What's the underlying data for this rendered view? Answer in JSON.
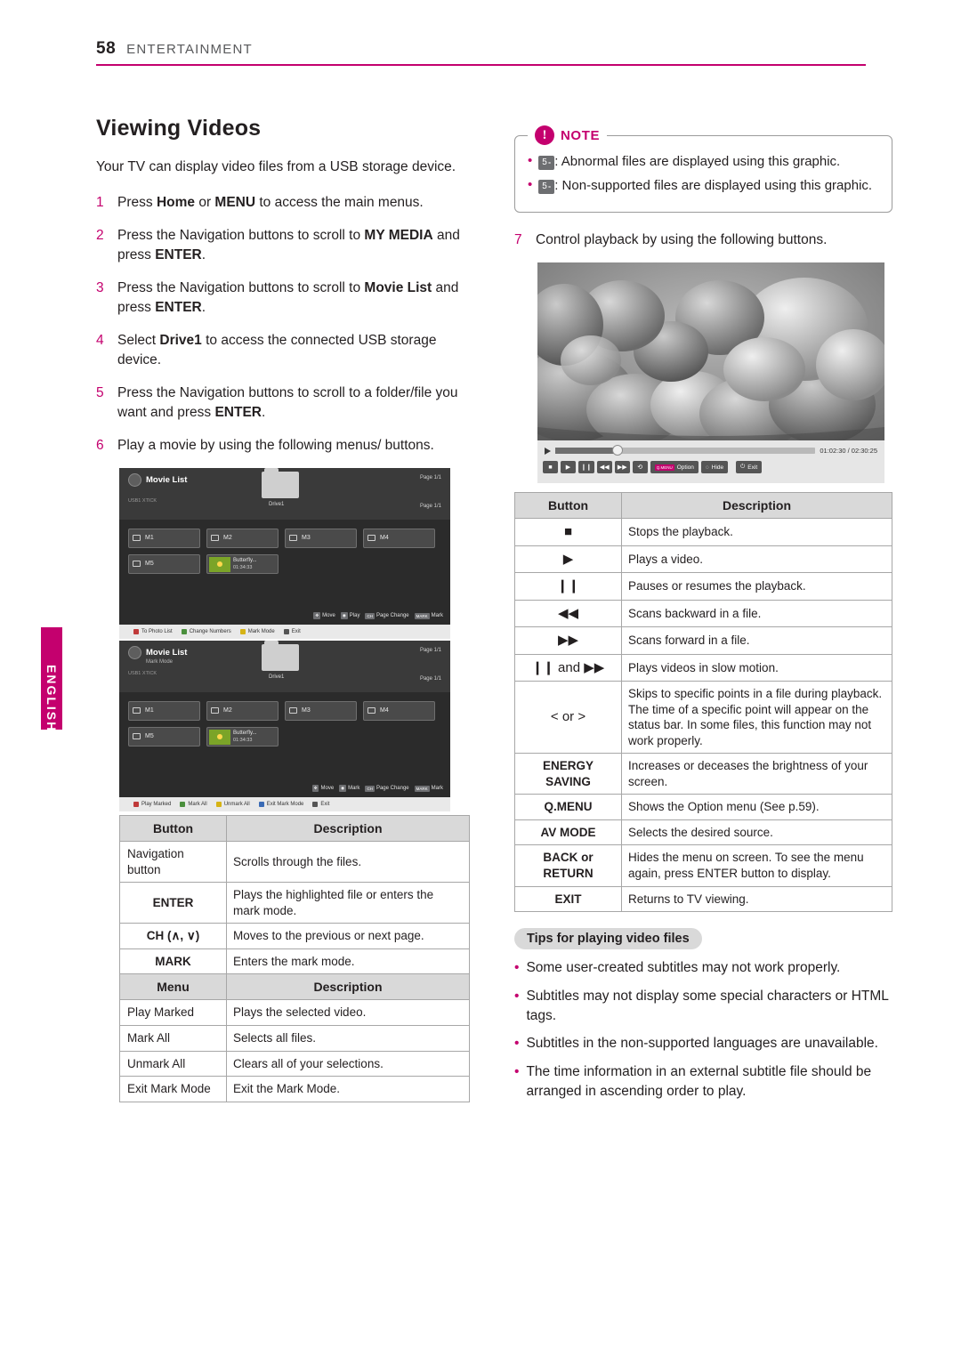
{
  "header": {
    "page_number": "58",
    "title": "ENTERTAINMENT"
  },
  "side_tab": {
    "label": "ENGLISH"
  },
  "left": {
    "section_title": "Viewing Videos",
    "intro": "Your TV can display video files from a USB storage device.",
    "steps": [
      {
        "n": "1",
        "html": "Press <b>Home</b> or <b>MENU</b> to access the main menus."
      },
      {
        "n": "2",
        "html": "Press the Navigation buttons to scroll to <b>MY MEDIA</b> and press <b>ENTER</b>."
      },
      {
        "n": "3",
        "html": "Press the Navigation buttons to scroll to <b>Movie List</b> and press <b>ENTER</b>."
      },
      {
        "n": "4",
        "html": "Select <b>Drive1</b> to access the connected USB storage device."
      },
      {
        "n": "5",
        "html": "Press the Navigation buttons to scroll to a folder/file you want and press <b>ENTER</b>."
      },
      {
        "n": "6",
        "html": "Play a movie by using the following menus/ buttons."
      }
    ],
    "button_table": {
      "headers": [
        "Button",
        "Description"
      ],
      "rows": [
        {
          "key": "Navigation button",
          "key_align": "left",
          "desc": "Scrolls through the files."
        },
        {
          "key": "ENTER",
          "key_align": "center",
          "desc": "Plays the highlighted file or enters the mark mode."
        },
        {
          "key": "CH (∧, ∨)",
          "key_align": "center",
          "desc": "Moves to the previous or next page."
        },
        {
          "key": "MARK",
          "key_align": "center",
          "desc": "Enters the mark mode."
        }
      ]
    },
    "menu_table": {
      "headers": [
        "Menu",
        "Description"
      ],
      "rows": [
        {
          "key": "Play Marked",
          "desc": "Plays the selected video."
        },
        {
          "key": "Mark All",
          "desc": "Selects all files."
        },
        {
          "key": "Unmark All",
          "desc": "Clears all of your selections."
        },
        {
          "key": "Exit Mark Mode",
          "desc": "Exit the Mark Mode."
        }
      ]
    },
    "mock1": {
      "title": "Movie List",
      "subtitle": "",
      "usb": "USB1 XTICK",
      "page_top": "Page 1/1",
      "page_right": "Page 1/1",
      "drive": "Drive1",
      "tiles_row1": [
        "M1",
        "M2",
        "M3",
        "M4"
      ],
      "tiles_row2": [
        "M5"
      ],
      "thumb_title": "Butterfly...",
      "thumb_time": "01:34:33",
      "hints": [
        {
          "k": "✥",
          "t": "Move"
        },
        {
          "k": "◉",
          "t": "Play"
        },
        {
          "k": "CH",
          "t": "Page Change"
        },
        {
          "k": "MARK",
          "t": "Mark"
        }
      ],
      "footer": [
        {
          "c": "r",
          "t": "To Photo List"
        },
        {
          "c": "g",
          "t": "Change Numbers"
        },
        {
          "c": "y",
          "t": "Mark Mode"
        },
        {
          "c": "k",
          "t": "Exit"
        }
      ]
    },
    "mock2": {
      "title": "Movie List",
      "subtitle": "Mark Mode",
      "usb": "USB1 XTICK",
      "page_top": "Page 1/1",
      "page_right": "Page 1/1",
      "drive": "Drive1",
      "tiles_row1": [
        "M1",
        "M2",
        "M3",
        "M4"
      ],
      "tiles_row2": [
        "M5"
      ],
      "thumb_title": "Butterfly...",
      "thumb_time": "01:34:33",
      "hints": [
        {
          "k": "✥",
          "t": "Move"
        },
        {
          "k": "◉",
          "t": "Mark"
        },
        {
          "k": "CH",
          "t": "Page Change"
        },
        {
          "k": "MARK",
          "t": "Mark"
        }
      ],
      "footer": [
        {
          "c": "r",
          "t": "Play Marked"
        },
        {
          "c": "g",
          "t": "Mark All"
        },
        {
          "c": "y",
          "t": "Unmark All"
        },
        {
          "c": "b",
          "t": "Exit Mark Mode"
        },
        {
          "c": "k",
          "t": "Exit"
        }
      ]
    }
  },
  "right": {
    "note": {
      "label": "NOTE",
      "items": [
        {
          "badge": "5",
          "badge_sub": "∘",
          "text": ": Abnormal files are displayed using this graphic."
        },
        {
          "badge": "5",
          "badge_sub": "∘",
          "text": ": Non-supported files are displayed using this graphic."
        }
      ]
    },
    "step7": {
      "n": "7",
      "text": "Control playback by using the following buttons."
    },
    "player": {
      "time": "01:02:30 / 02:30:25",
      "buttons": [
        "■",
        "▶",
        "❙❙",
        "◀◀",
        "▶▶",
        "⟲"
      ],
      "option_label": "Option",
      "option_key": "Q.MENU",
      "hide_label": "Hide",
      "exit_label": "Exit"
    },
    "button_table": {
      "headers": [
        "Button",
        "Description"
      ],
      "rows": [
        {
          "key": "■",
          "type": "sym",
          "desc": "Stops the playback."
        },
        {
          "key": "▶",
          "type": "sym",
          "desc": "Plays a video."
        },
        {
          "key": "❙❙",
          "type": "sym",
          "desc": "Pauses or resumes the playback."
        },
        {
          "key": "◀◀",
          "type": "sym",
          "desc": "Scans backward in a file."
        },
        {
          "key": "▶▶",
          "type": "sym",
          "desc": "Scans forward in a file."
        },
        {
          "key": "❙❙ and ▶▶",
          "type": "sym",
          "desc": "Plays videos in slow motion."
        },
        {
          "key": "< or >",
          "type": "sym",
          "desc": "Skips to specific points in a file during playback. The time of a specific point will appear on the status bar. In some files, this function may not work properly."
        },
        {
          "key": "ENERGY SAVING",
          "type": "key",
          "desc": "Increases or deceases the brightness of your screen."
        },
        {
          "key": "Q.MENU",
          "type": "key",
          "desc": "Shows the Option menu (See p.59)."
        },
        {
          "key": "AV MODE",
          "type": "key",
          "desc": "Selects the desired source."
        },
        {
          "key": "BACK or RETURN",
          "type": "key",
          "desc": "Hides the menu on screen. To see the menu again, press ENTER button to display."
        },
        {
          "key": "EXIT",
          "type": "key",
          "desc": "Returns to TV viewing."
        }
      ]
    },
    "tips": {
      "pill": "Tips for playing video files",
      "items": [
        "Some user-created subtitles may not work properly.",
        "Subtitles may not display some special characters or HTML tags.",
        "Subtitles in the non-supported languages are unavailable.",
        "The time information in an external subtitle file should be arranged in ascending order to play."
      ]
    }
  }
}
